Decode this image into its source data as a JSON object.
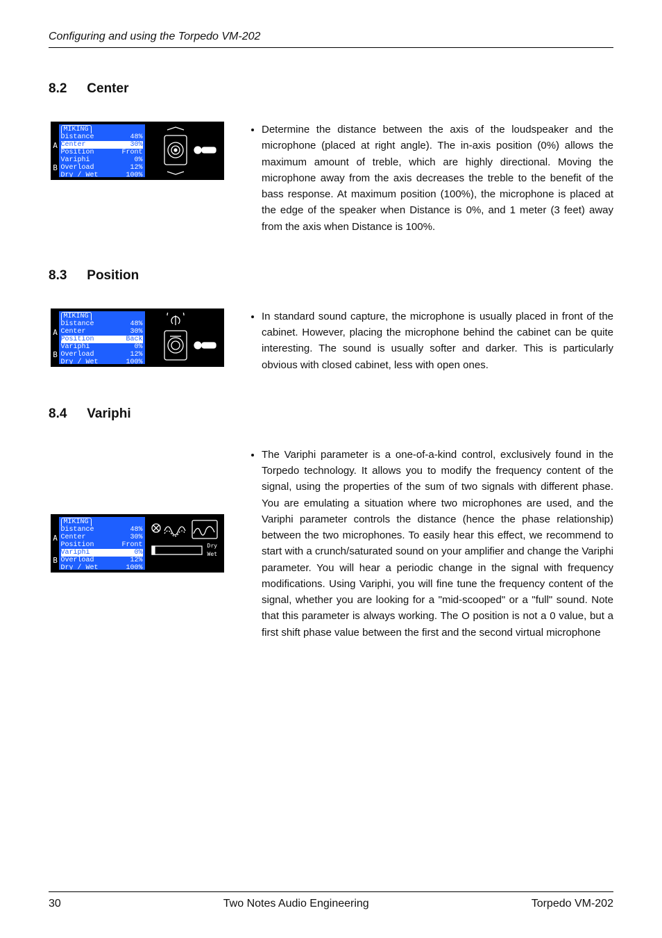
{
  "header": "Configuring and using the Torpedo VM-202",
  "sections": {
    "s82": {
      "num": "8.2",
      "title": "Center",
      "bullet": "Determine the distance between the axis of the loudspeaker and the microphone (placed at right angle). The in-axis position (0%) allows the maximum amount of treble, which are highly directional. Moving the microphone away from the axis decreases the treble to the benefit of the bass response. At maximum position (100%), the microphone is placed at the edge of the speaker when Distance is 0%, and 1 meter (3 feet) away from the axis when Distance is 100%."
    },
    "s83": {
      "num": "8.3",
      "title": "Position",
      "bullet": "In standard sound capture, the microphone is usually placed in front of the cabinet. However, placing the microphone behind the cabinet can be quite interesting. The sound is usually softer and darker. This is particularly obvious with closed cabinet, less with open ones."
    },
    "s84": {
      "num": "8.4",
      "title": "Variphi",
      "bullet": "The Variphi parameter is a one-of-a-kind control, exclusively found in the Torpedo technology. It allows you to modify the frequency content of the signal, using the properties of the sum of two signals with different phase. You are emulating a situation where two microphones are used, and the Variphi parameter controls the distance (hence the phase relationship) between the two microphones. To easily hear this effect, we recommend to start with a crunch/saturated sound on your amplifier and change the Variphi parameter. You will hear a periodic change in the signal with frequency modifications. Using Variphi, you will fine tune the frequency content of the signal, whether you are looking for a \"mid-scooped\" or a \"full\" sound. Note that this parameter is always working. The O position is not a 0 value, but a first shift phase value between the first and the second virtual microphone"
    }
  },
  "miking": {
    "title": "MIKING",
    "labels": {
      "a": "A",
      "b": "B"
    },
    "rows": {
      "distance": {
        "label": "Distance",
        "value": "48%"
      },
      "center": {
        "label": "Center",
        "value": "30%"
      },
      "positionFront": {
        "label": "Position",
        "value": "Front"
      },
      "positionBack": {
        "label": "Position",
        "value": "Back"
      },
      "variphi": {
        "label": "Variphi",
        "value": "0%"
      },
      "overload": {
        "label": "Overload",
        "value": "12%"
      },
      "drywet": {
        "label": "Dry / Wet",
        "value": "100%"
      }
    },
    "variFig": {
      "dry": "Dry",
      "wet": "Wet"
    }
  },
  "footer": {
    "page": "30",
    "center": "Two Notes Audio Engineering",
    "right": "Torpedo VM-202"
  }
}
